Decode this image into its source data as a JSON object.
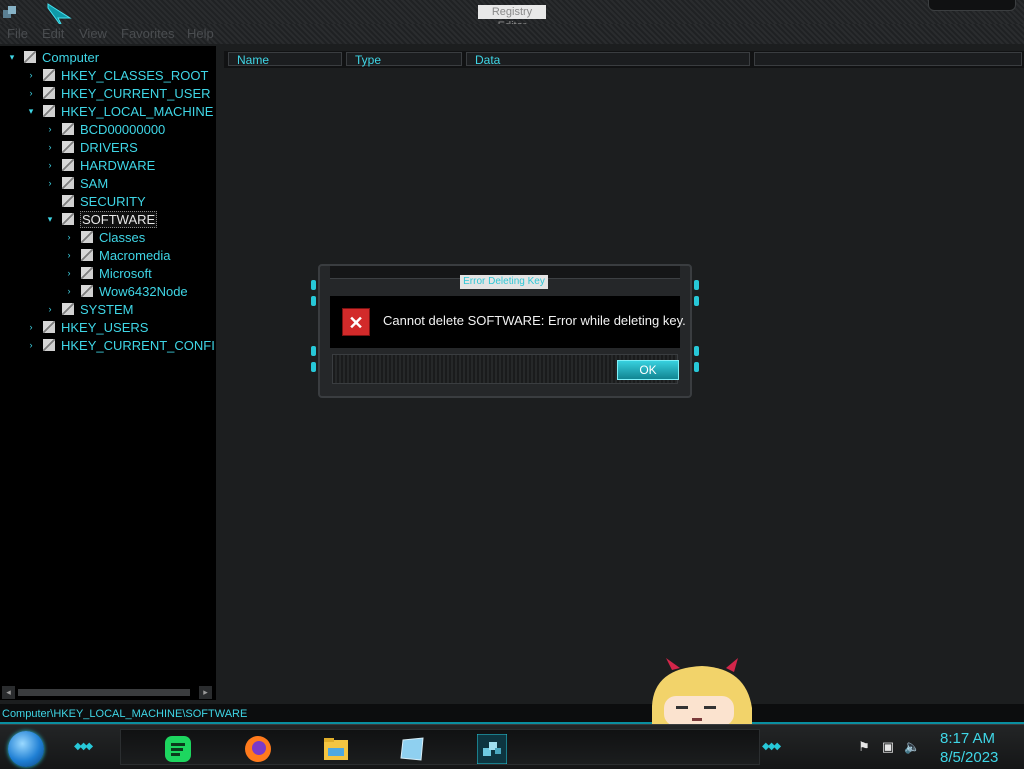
{
  "window": {
    "title": "Registry Editor"
  },
  "menu": [
    "File",
    "Edit",
    "View",
    "Favorites",
    "Help"
  ],
  "tree": [
    {
      "label": "Computer",
      "depth": 0,
      "expander": "▾"
    },
    {
      "label": "HKEY_CLASSES_ROOT",
      "depth": 1,
      "expander": "›"
    },
    {
      "label": "HKEY_CURRENT_USER",
      "depth": 1,
      "expander": "›"
    },
    {
      "label": "HKEY_LOCAL_MACHINE",
      "depth": 1,
      "expander": "▾"
    },
    {
      "label": "BCD00000000",
      "depth": 2,
      "expander": "›"
    },
    {
      "label": "DRIVERS",
      "depth": 2,
      "expander": "›"
    },
    {
      "label": "HARDWARE",
      "depth": 2,
      "expander": "›"
    },
    {
      "label": "SAM",
      "depth": 2,
      "expander": "›"
    },
    {
      "label": "SECURITY",
      "depth": 2,
      "expander": ""
    },
    {
      "label": "SOFTWARE",
      "depth": 2,
      "expander": "▾",
      "selected": true
    },
    {
      "label": "Classes",
      "depth": 3,
      "expander": "›"
    },
    {
      "label": "Macromedia",
      "depth": 3,
      "expander": "›"
    },
    {
      "label": "Microsoft",
      "depth": 3,
      "expander": "›"
    },
    {
      "label": "Wow6432Node",
      "depth": 3,
      "expander": "›"
    },
    {
      "label": "SYSTEM",
      "depth": 2,
      "expander": "›"
    },
    {
      "label": "HKEY_USERS",
      "depth": 1,
      "expander": "›"
    },
    {
      "label": "HKEY_CURRENT_CONFI",
      "depth": 1,
      "expander": "›"
    }
  ],
  "columns": [
    "Name",
    "Type",
    "Data"
  ],
  "status": {
    "path": "Computer\\HKEY_LOCAL_MACHINE\\SOFTWARE"
  },
  "dialog": {
    "title": "Error Deleting Key",
    "message": "Cannot delete SOFTWARE:  Error while deleting key.",
    "ok_label": "OK"
  },
  "taskbar": {
    "apps": [
      "spotify-icon",
      "firefox-icon",
      "file-explorer-icon",
      "window-icon",
      "registry-editor-icon"
    ],
    "tray": [
      "flag-icon",
      "network-icon",
      "volume-icon"
    ],
    "time": "8:17 AM",
    "date": "8/5/2023"
  },
  "colors": {
    "accent": "#3fd6e6",
    "selected_text": "#e8e8e8",
    "error": "#d22a2a"
  }
}
